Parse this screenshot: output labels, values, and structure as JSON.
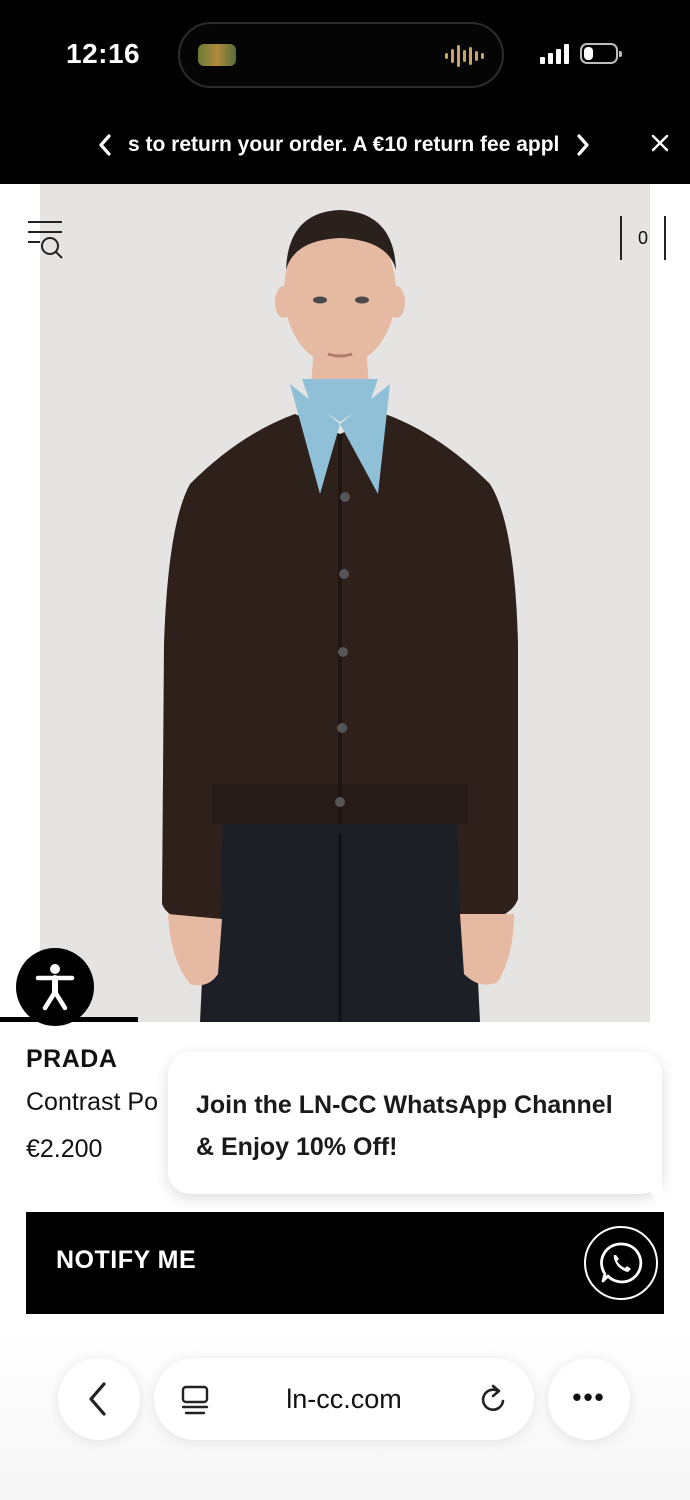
{
  "status_bar": {
    "time": "12:16",
    "battery_level": 0.3
  },
  "announcement": {
    "text": "s to return your order. A €10 return fee appl",
    "prev_icon": "chevron-left-icon",
    "next_icon": "chevron-right-icon",
    "close_icon": "close-icon"
  },
  "header": {
    "menu_icon": "menu-search-icon",
    "cart_count": "0"
  },
  "product": {
    "brand": "PRADA",
    "name": "Contrast Po",
    "price": "€2.200",
    "image_colors": {
      "background": "#e5e4e2",
      "cardigan": "#2e211b",
      "collar": "#8fc0d8",
      "trousers": "#1c1f26",
      "skin": "#e6b9a2"
    }
  },
  "promo": {
    "text": "Join the LN-CC WhatsApp Channel & Enjoy 10% Off!"
  },
  "cta": {
    "notify_label": "NOTIFY ME"
  },
  "browser": {
    "url": "ln-cc.com"
  }
}
